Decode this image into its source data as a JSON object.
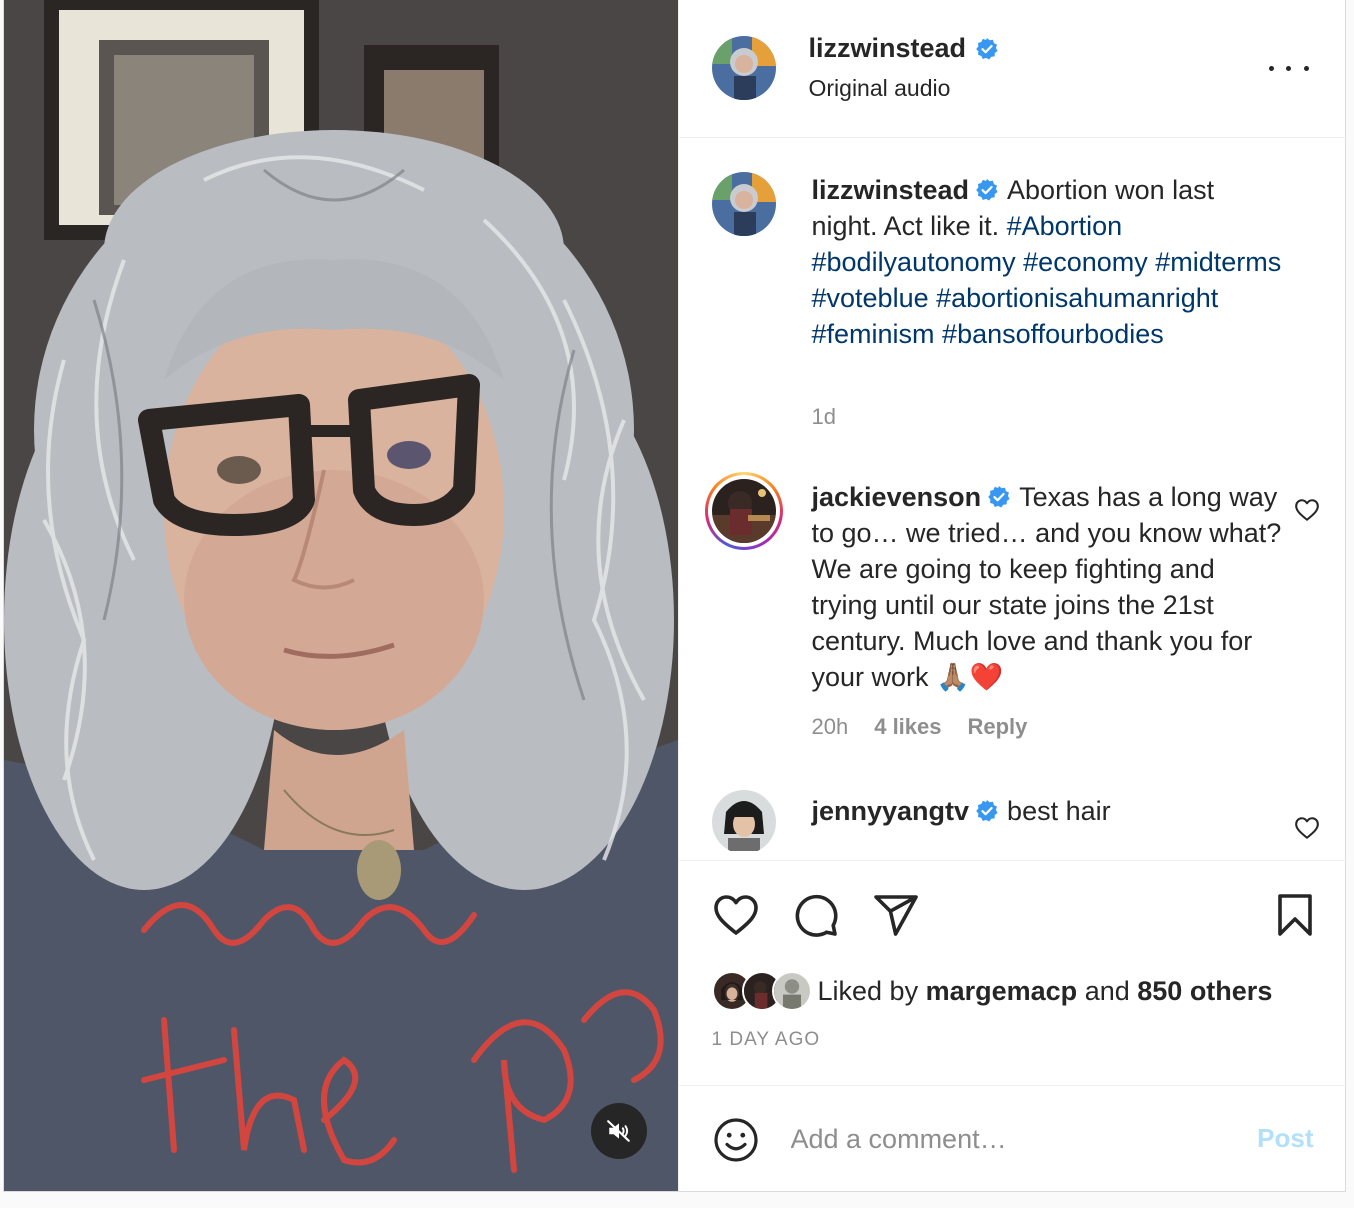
{
  "post": {
    "author": "lizzwinstead",
    "audio_label": "Original audio",
    "media_alt": "selfie video of a woman with grey curly hair and glasses"
  },
  "caption": {
    "username": "lizzwinstead",
    "text": "Abortion won last night. Act like it.",
    "hashtags": [
      "#Abortion",
      "#bodilyautonomy",
      "#economy",
      "#midterms",
      "#voteblue",
      "#abortionisahumanright",
      "#feminism",
      "#bansoffourbodies"
    ],
    "age": "1d"
  },
  "comments": [
    {
      "username": "jackievenson",
      "text": "Texas has a long way to go… we tried… and you know what? We are going to keep fighting and trying until our state joins the 21st century. Much love and thank you for your work 🙏🏽❤️",
      "age": "20h",
      "likes": "4 likes",
      "reply": "Reply"
    },
    {
      "username": "jennyyangtv",
      "text": "best hair"
    }
  ],
  "likes": {
    "prefix": "Liked by",
    "first_user": "margemacp",
    "joiner": "and",
    "others": "850 others"
  },
  "timestamp": "1 DAY AGO",
  "composer": {
    "placeholder": "Add a comment…",
    "post_label": "Post"
  },
  "colors": {
    "verified": "#3897f0",
    "hashtag": "#00376b",
    "post_button_disabled": "#b2dffc"
  },
  "icons": {
    "media": [
      "mute-icon"
    ],
    "actions": [
      "heart-icon",
      "comment-icon",
      "share-icon",
      "bookmark-icon"
    ],
    "header": [
      "more-options-icon",
      "verified-badge-icon"
    ],
    "composer": [
      "emoji-icon"
    ]
  }
}
